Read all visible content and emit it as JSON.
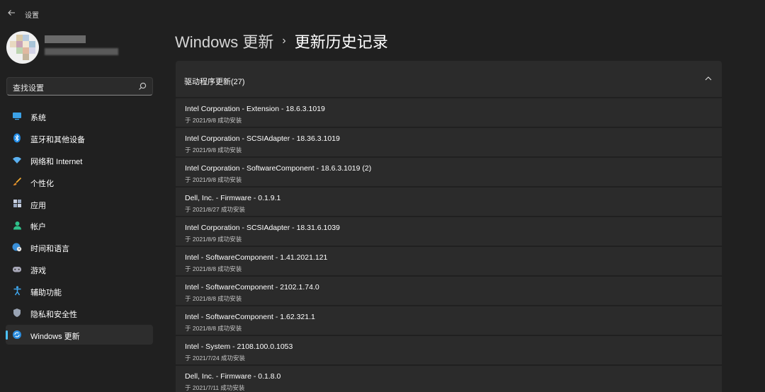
{
  "window": {
    "title": "设置"
  },
  "sidebar": {
    "search": {
      "placeholder": "查找设置"
    },
    "items": [
      {
        "label": "系统",
        "icon": "system-display-icon"
      },
      {
        "label": "蓝牙和其他设备",
        "icon": "bluetooth-icon"
      },
      {
        "label": "网络和 Internet",
        "icon": "wifi-icon"
      },
      {
        "label": "个性化",
        "icon": "paintbrush-icon"
      },
      {
        "label": "应用",
        "icon": "apps-icon"
      },
      {
        "label": "帐户",
        "icon": "account-icon"
      },
      {
        "label": "时间和语言",
        "icon": "globe-clock-icon"
      },
      {
        "label": "游戏",
        "icon": "gamepad-icon"
      },
      {
        "label": "辅助功能",
        "icon": "accessibility-icon"
      },
      {
        "label": "隐私和安全性",
        "icon": "shield-icon"
      },
      {
        "label": "Windows 更新",
        "icon": "windows-update-icon",
        "active": true
      }
    ]
  },
  "breadcrumb": {
    "root": "Windows 更新",
    "separator": "›",
    "current": "更新历史记录"
  },
  "section": {
    "title": "驱动程序更新(27)"
  },
  "updates": [
    {
      "name": "Intel Corporation - Extension - 18.6.3.1019",
      "status": "于 2021/9/8 成功安装"
    },
    {
      "name": "Intel Corporation - SCSIAdapter - 18.36.3.1019",
      "status": "于 2021/9/8 成功安装"
    },
    {
      "name": "Intel Corporation - SoftwareComponent - 18.6.3.1019 (2)",
      "status": "于 2021/9/8 成功安装"
    },
    {
      "name": "Dell, Inc. - Firmware - 0.1.9.1",
      "status": "于 2021/8/27 成功安装"
    },
    {
      "name": "Intel Corporation - SCSIAdapter - 18.31.6.1039",
      "status": "于 2021/8/9 成功安装"
    },
    {
      "name": "Intel - SoftwareComponent - 1.41.2021.121",
      "status": "于 2021/8/8 成功安装"
    },
    {
      "name": "Intel - SoftwareComponent - 2102.1.74.0",
      "status": "于 2021/8/8 成功安装"
    },
    {
      "name": "Intel - SoftwareComponent - 1.62.321.1",
      "status": "于 2021/8/8 成功安装"
    },
    {
      "name": "Intel - System - 2108.100.0.1053",
      "status": "于 2021/7/24 成功安装"
    },
    {
      "name": "Dell, Inc. - Firmware - 0.1.8.0",
      "status": "于 2021/7/11 成功安装"
    }
  ],
  "colors": {
    "background": "#202020",
    "card": "#2b2b2b",
    "accent": "#4cc2ff"
  }
}
